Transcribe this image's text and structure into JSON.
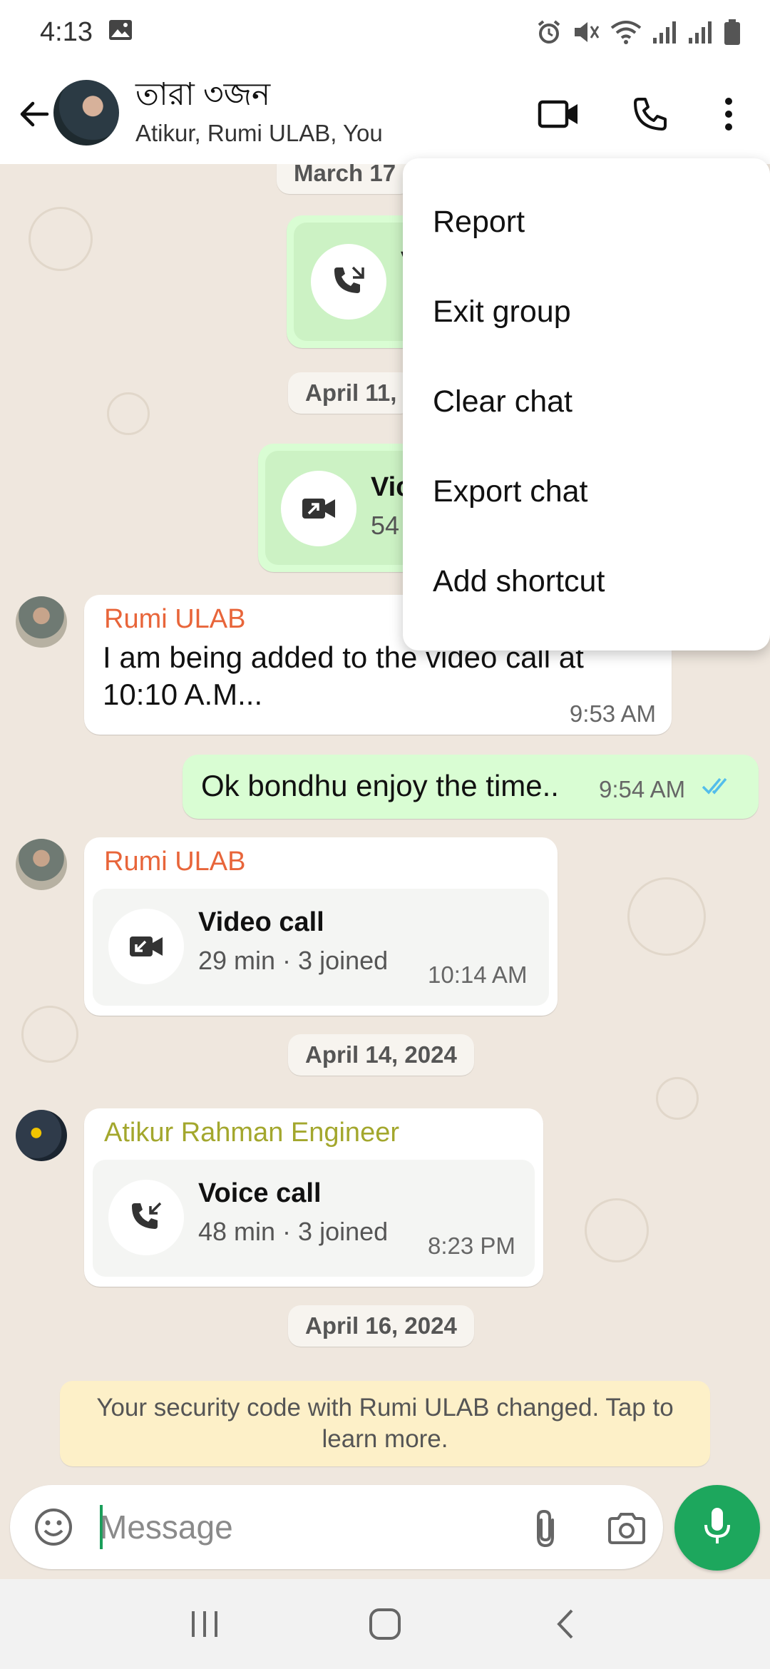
{
  "status_bar": {
    "time": "4:13",
    "left_icons": [
      "gallery-icon"
    ],
    "right_icons": [
      "alarm-icon",
      "mute-icon",
      "wifi-icon",
      "signal-icon",
      "signal-icon",
      "battery-icon"
    ]
  },
  "header": {
    "group_name": "তারা ৩জন",
    "members": "Atikur, Rumi ULAB, You",
    "icons": [
      "back-arrow-icon",
      "video-call-icon",
      "phone-icon",
      "more-vert-icon"
    ]
  },
  "menu": {
    "items": [
      "Report",
      "Exit group",
      "Clear chat",
      "Export chat",
      "Add shortcut"
    ]
  },
  "chat": {
    "dates": [
      "March 17",
      "April 11,",
      "April 14, 2024",
      "April 16, 2024"
    ],
    "partial_outgoing_1": {
      "title_fragment": "V",
      "icon": "phone-missed-icon"
    },
    "partial_outgoing_2": {
      "title_fragment": "Vic",
      "sub_fragment": "54",
      "icon": "video-outgoing-icon"
    },
    "messages": [
      {
        "sender": "Rumi ULAB",
        "sender_color": "#e8653a",
        "text": "I am being added to the video call at 10:10 A.M...",
        "time": "9:53 AM"
      },
      {
        "sender": "You",
        "text": "Ok bondhu enjoy the time..",
        "time": "9:54 AM",
        "status": "read-check-icon"
      },
      {
        "sender": "Rumi ULAB",
        "sender_color": "#e8653a",
        "call_title": "Video call",
        "call_sub": "29 min · 3 joined",
        "time": "10:14 AM",
        "icon": "video-incoming-icon"
      },
      {
        "sender": "Atikur Rahman Engineer",
        "sender_color": "#a3a72d",
        "call_title": "Voice call",
        "call_sub": "48 min · 3 joined",
        "time": "8:23 PM",
        "icon": "phone-incoming-icon"
      }
    ],
    "security_note": "Your security code with Rumi ULAB changed. Tap to learn more."
  },
  "input_bar": {
    "placeholder": "Message",
    "icons": [
      "emoji-icon",
      "attach-icon",
      "camera-icon",
      "mic-icon"
    ]
  },
  "nav_bar": {
    "icons": [
      "recents-icon",
      "home-icon",
      "back-icon"
    ]
  },
  "colors": {
    "accent": "#1da75d",
    "outgoing_bubble": "#d9fdd3",
    "chat_bg": "#efe7de",
    "read_check": "#53bdeb"
  }
}
